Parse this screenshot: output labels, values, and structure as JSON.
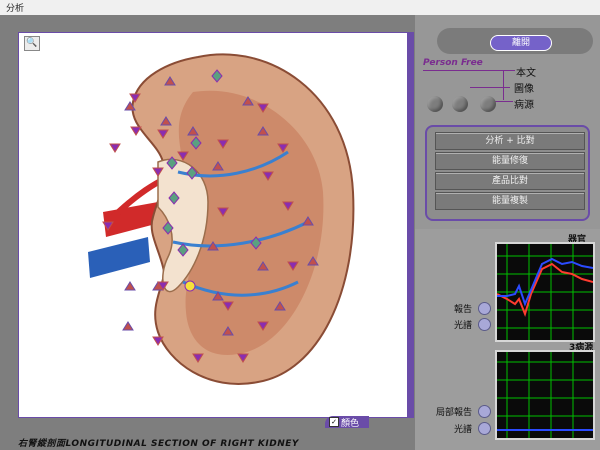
{
  "window": {
    "title": "分析"
  },
  "image_view": {
    "zoom_icon": "magnifier-icon",
    "color_toggle_label": "顏色",
    "caption": "右腎縱剖面LONGITUDINAL SECTION OF RIGHT KIDNEY"
  },
  "header": {
    "leave_label": "離開",
    "brand": "Person Free"
  },
  "options": [
    "本文",
    "圖像",
    "病源"
  ],
  "menu": [
    "分析 + 比對",
    "能量修復",
    "產品比對",
    "能量複製"
  ],
  "charts": [
    {
      "title": "器官",
      "buttons": [
        "報告",
        "光譜"
      ]
    },
    {
      "title": "3病源",
      "buttons": [
        "局部報告",
        "光譜"
      ]
    }
  ],
  "colors": {
    "accent": "#6a4ca8",
    "brand": "#7a2d8f",
    "chart_bg": "#0a0a0a",
    "grid": "#00c000",
    "series_red": "#ff3b2f",
    "series_blue": "#2b4bff"
  }
}
